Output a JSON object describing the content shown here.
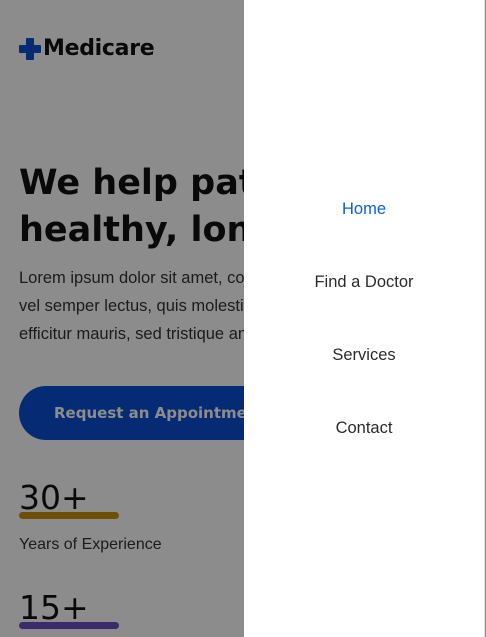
{
  "brand": {
    "name": "Medicare",
    "icon": "plus-cross-icon",
    "color": "#0a4fd6"
  },
  "hero": {
    "title_line1": "We help patients live a",
    "title_line2": "healthy, longer life.",
    "desc_line1": "Lorem ipsum dolor sit amet, consectetur adipiscing elit. Integer",
    "desc_line2": "vel semper lectus, quis molestie metus. Nulla facilisi. Morbi",
    "desc_line3": "efficitur mauris, sed tristique ante ultrices at.",
    "cta_label": "Request an Appointment"
  },
  "stats": [
    {
      "value": "30+",
      "label": "Years of Experience",
      "bar_color": "#f0a500"
    },
    {
      "value": "15+",
      "label": "",
      "bar_color": "#8a63e6"
    }
  ],
  "nav": {
    "items": [
      {
        "label": "Home",
        "active": true
      },
      {
        "label": "Find a Doctor",
        "active": false
      },
      {
        "label": "Services",
        "active": false
      },
      {
        "label": "Contact",
        "active": false
      }
    ],
    "active_color": "#0a5fdc"
  }
}
